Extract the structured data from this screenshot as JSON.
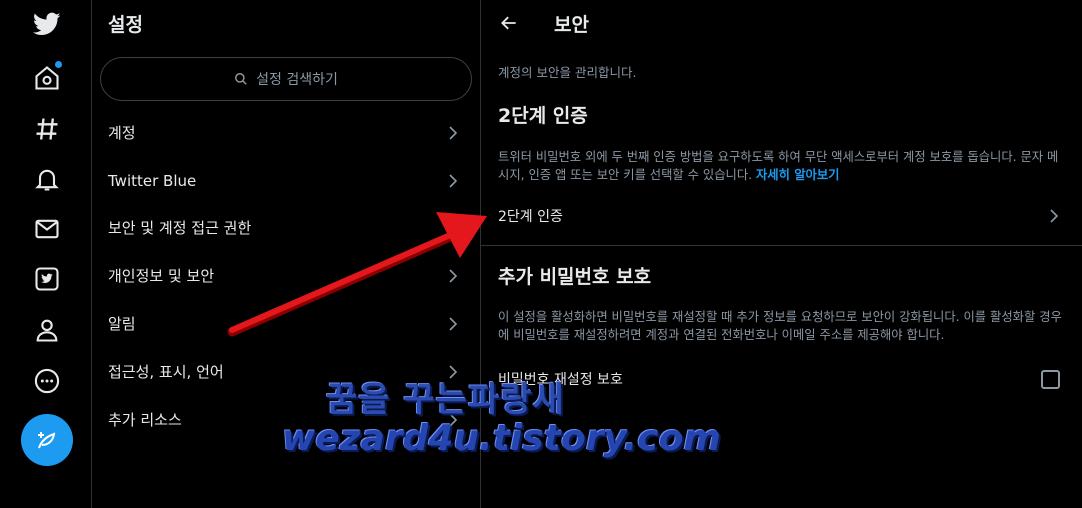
{
  "rail": {
    "icons": [
      "twitter-logo-icon",
      "home-icon",
      "explore-hashtag-icon",
      "notifications-bell-icon",
      "messages-mail-icon",
      "twitter-blue-icon",
      "profile-icon",
      "more-icon",
      "compose-tweet-icon"
    ],
    "accent": "#1d9bf0"
  },
  "settings": {
    "title": "설정",
    "search_placeholder": "설정 검색하기",
    "items": [
      {
        "label": "계정"
      },
      {
        "label": "Twitter Blue"
      },
      {
        "label": "보안 및 계정 접근 권한"
      },
      {
        "label": "개인정보 및 보안"
      },
      {
        "label": "알림"
      },
      {
        "label": "접근성, 표시, 언어"
      },
      {
        "label": "추가 리소스"
      }
    ]
  },
  "security": {
    "title": "보안",
    "subtitle": "계정의 보안을 관리합니다.",
    "two_factor": {
      "heading": "2단계 인증",
      "description": "트위터 비밀번호 외에 두 번째 인증 방법을 요구하도록 하여 무단 액세스로부터 계정 보호를 돕습니다. 문자 메시지, 인증 앱 또는 보안 키를 선택할 수 있습니다.",
      "learn_more": "자세히 알아보기",
      "row_label": "2단계 인증"
    },
    "password_protection": {
      "heading": "추가 비밀번호 보호",
      "description": "이 설정을 활성화하면 비밀번호를 재설정할 때 추가 정보를 요청하므로 보안이 강화됩니다. 이를 활성화할 경우에 비밀번호를 재설정하려면 계정과 연결된 전화번호나 이메일 주소를 제공해야 합니다.",
      "row_label": "비밀번호 재설정 보호",
      "checked": false
    }
  },
  "watermark": {
    "line1": "꿈을 꾸는파랑새",
    "line2": "wezard4u.tistory.com"
  }
}
